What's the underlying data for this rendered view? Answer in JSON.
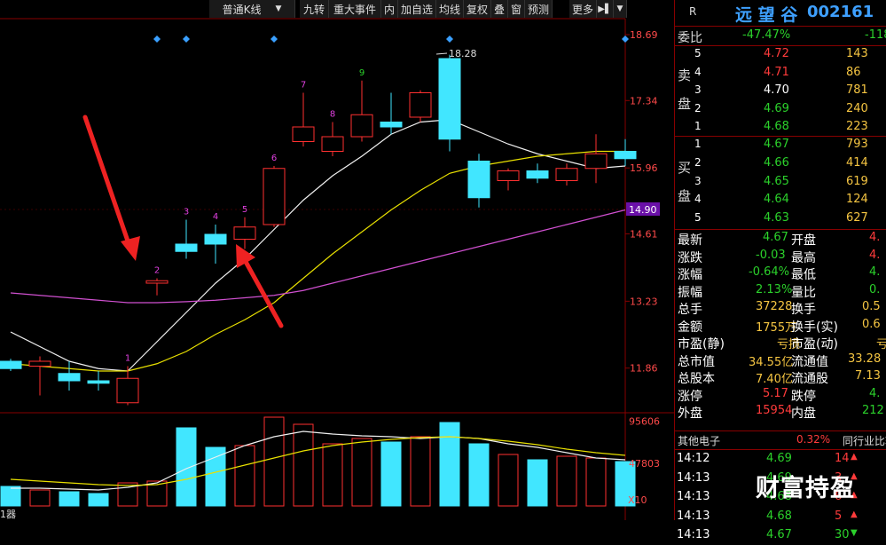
{
  "toolbar": {
    "items": [
      "普通K线",
      "▼",
      "九转",
      "重大事件",
      "内",
      "加自选",
      "均线",
      "复权",
      "叠",
      "窗",
      "预测",
      "更多"
    ],
    "nav_icon": "▶▌",
    "dropdown": "▼"
  },
  "stock": {
    "flag": "R",
    "name": "远 望 谷",
    "code": "002161"
  },
  "weibi": {
    "label": "委比",
    "pct": "-47.47%",
    "diff": "-118"
  },
  "sell_label": [
    "卖",
    "盘"
  ],
  "buy_label": [
    "买",
    "盘"
  ],
  "sell_orders": [
    {
      "level": "5",
      "price": "4.72",
      "vol": "143",
      "color": "red"
    },
    {
      "level": "4",
      "price": "4.71",
      "vol": "86",
      "color": "red"
    },
    {
      "level": "3",
      "price": "4.70",
      "vol": "781",
      "color": "white"
    },
    {
      "level": "2",
      "price": "4.69",
      "vol": "240",
      "color": "green"
    },
    {
      "level": "1",
      "price": "4.68",
      "vol": "223",
      "color": "green"
    }
  ],
  "buy_orders": [
    {
      "level": "1",
      "price": "4.67",
      "vol": "793",
      "color": "green"
    },
    {
      "level": "2",
      "price": "4.66",
      "vol": "414",
      "color": "green"
    },
    {
      "level": "3",
      "price": "4.65",
      "vol": "619",
      "color": "green"
    },
    {
      "level": "4",
      "price": "4.64",
      "vol": "124",
      "color": "green"
    },
    {
      "level": "5",
      "price": "4.63",
      "vol": "627",
      "color": "green"
    }
  ],
  "stats": [
    {
      "l1": "最新",
      "v1": "4.67",
      "c1": "green",
      "l2": "开盘",
      "v2": "4.",
      "c2": "red"
    },
    {
      "l1": "涨跌",
      "v1": "-0.03",
      "c1": "green",
      "l2": "最高",
      "v2": "4.",
      "c2": "red"
    },
    {
      "l1": "涨幅",
      "v1": "-0.64%",
      "c1": "green",
      "l2": "最低",
      "v2": "4.",
      "c2": "green"
    },
    {
      "l1": "振幅",
      "v1": "2.13%",
      "c1": "green",
      "l2": "量比",
      "v2": "0.",
      "c2": "green"
    },
    {
      "l1": "总手",
      "v1": "37228",
      "c1": "gold",
      "l2": "换手",
      "v2": "0.5",
      "c2": "gold"
    },
    {
      "l1": "金额",
      "v1": "1755万",
      "c1": "gold",
      "l2": "换手(实)",
      "v2": "0.6",
      "c2": "gold"
    },
    {
      "l1": "市盈(静)",
      "v1": "亏损",
      "c1": "gold",
      "l2": "市盈(动)",
      "v2": "亏",
      "c2": "gold"
    },
    {
      "l1": "总市值",
      "v1": "34.55亿",
      "c1": "gold",
      "l2": "流通值",
      "v2": "33.28",
      "c2": "gold"
    },
    {
      "l1": "总股本",
      "v1": "7.40亿",
      "c1": "gold",
      "l2": "流通股",
      "v2": "7.13",
      "c2": "gold"
    },
    {
      "l1": "涨停",
      "v1": "5.17",
      "c1": "red",
      "l2": "跌停",
      "v2": "4.",
      "c2": "green"
    },
    {
      "l1": "外盘",
      "v1": "15954",
      "c1": "red",
      "l2": "内盘",
      "v2": "212",
      "c2": "green"
    }
  ],
  "sector": {
    "name": "其他电子",
    "pct": "0.32%",
    "right": "同行业比较"
  },
  "ticks": [
    {
      "time": "14:12",
      "price": "4.69",
      "vol": "14",
      "dir": "up"
    },
    {
      "time": "14:13",
      "price": "4.69",
      "vol": "3",
      "dir": "up"
    },
    {
      "time": "14:13",
      "price": "4.68",
      "vol": "6",
      "dir": "up"
    },
    {
      "time": "14:13",
      "price": "4.68",
      "vol": "5",
      "dir": "up"
    },
    {
      "time": "14:13",
      "price": "4.67",
      "vol": "30",
      "dir": "down"
    }
  ],
  "watermark": "财富持盈",
  "chart_data": {
    "type": "candlestick",
    "price_ticks": [
      "18.69",
      "17.34",
      "15.96",
      "14.61",
      "13.23",
      "11.86"
    ],
    "current_price_label": "14.90",
    "max_label": "18.28",
    "volume_ticks": [
      "95606",
      "47803"
    ],
    "volume_unit": "X10",
    "left_label": "1器",
    "candles": [
      {
        "o": 12.0,
        "c": 11.85,
        "h": 12.05,
        "l": 11.8,
        "vol": 22000,
        "label": ""
      },
      {
        "o": 11.9,
        "c": 12.0,
        "h": 12.1,
        "l": 11.3,
        "vol": 18000,
        "label": ""
      },
      {
        "o": 11.75,
        "c": 11.6,
        "h": 12.0,
        "l": 11.4,
        "vol": 16000,
        "label": ""
      },
      {
        "o": 11.6,
        "c": 11.55,
        "h": 11.8,
        "l": 11.4,
        "vol": 14000,
        "label": ""
      },
      {
        "o": 11.15,
        "c": 11.65,
        "h": 11.9,
        "l": 11.1,
        "vol": 26000,
        "label": "1"
      },
      {
        "o": 13.6,
        "c": 13.65,
        "h": 13.7,
        "l": 13.35,
        "vol": 28000,
        "label": "2"
      },
      {
        "o": 14.4,
        "c": 14.25,
        "h": 14.9,
        "l": 14.1,
        "vol": 88000,
        "label": "3"
      },
      {
        "o": 14.6,
        "c": 14.4,
        "h": 14.8,
        "l": 14.0,
        "vol": 66000,
        "label": "4"
      },
      {
        "o": 14.5,
        "c": 14.75,
        "h": 14.95,
        "l": 14.3,
        "vol": 68000,
        "label": "5"
      },
      {
        "o": 14.8,
        "c": 15.95,
        "h": 16.0,
        "l": 14.75,
        "vol": 100000,
        "label": "6"
      },
      {
        "o": 16.5,
        "c": 16.8,
        "h": 17.5,
        "l": 16.4,
        "vol": 92000,
        "label": "7"
      },
      {
        "o": 16.3,
        "c": 16.6,
        "h": 16.9,
        "l": 16.2,
        "vol": 70000,
        "label": "8"
      },
      {
        "o": 16.6,
        "c": 17.05,
        "h": 17.75,
        "l": 16.5,
        "vol": 76000,
        "label": "9"
      },
      {
        "o": 16.9,
        "c": 16.8,
        "h": 17.5,
        "l": 16.65,
        "vol": 72000,
        "label": ""
      },
      {
        "o": 17.0,
        "c": 17.5,
        "h": 17.55,
        "l": 16.9,
        "vol": 78000,
        "label": ""
      },
      {
        "o": 18.2,
        "c": 16.55,
        "h": 18.28,
        "l": 16.3,
        "vol": 94000,
        "label": ""
      },
      {
        "o": 16.1,
        "c": 15.35,
        "h": 16.25,
        "l": 15.15,
        "vol": 70000,
        "label": ""
      },
      {
        "o": 15.7,
        "c": 15.9,
        "h": 15.95,
        "l": 15.5,
        "vol": 58000,
        "label": ""
      },
      {
        "o": 15.9,
        "c": 15.75,
        "h": 16.05,
        "l": 15.65,
        "vol": 52000,
        "label": ""
      },
      {
        "o": 15.7,
        "c": 15.95,
        "h": 16.05,
        "l": 15.6,
        "vol": 56000,
        "label": ""
      },
      {
        "o": 15.95,
        "c": 16.25,
        "h": 16.65,
        "l": 15.65,
        "vol": 54000,
        "label": ""
      },
      {
        "o": 16.3,
        "c": 16.15,
        "h": 16.55,
        "l": 16.0,
        "vol": 50000,
        "label": ""
      }
    ],
    "ma5": [
      12.6,
      12.3,
      12.0,
      11.85,
      11.8,
      12.4,
      13.0,
      13.6,
      14.1,
      14.7,
      15.3,
      15.8,
      16.2,
      16.65,
      16.9,
      16.95,
      16.7,
      16.45,
      16.25,
      16.1,
      15.95,
      16.0
    ],
    "ma10": [
      11.95,
      11.9,
      11.85,
      11.8,
      11.8,
      11.95,
      12.2,
      12.55,
      12.85,
      13.2,
      13.7,
      14.2,
      14.65,
      15.1,
      15.5,
      15.85,
      16.0,
      16.1,
      16.2,
      16.25,
      16.3,
      16.3
    ],
    "ma20": [
      13.4,
      13.35,
      13.3,
      13.25,
      13.2,
      13.2,
      13.22,
      13.25,
      13.3,
      13.35,
      13.45,
      13.6,
      13.75,
      13.9,
      14.05,
      14.2,
      14.35,
      14.5,
      14.65,
      14.8,
      14.95,
      15.1
    ],
    "vol_ma5": [
      20000,
      20000,
      19000,
      18000,
      21000,
      26000,
      42000,
      55000,
      68000,
      78000,
      84000,
      81000,
      79000,
      78000,
      76000,
      78000,
      76000,
      70000,
      66000,
      60000,
      54000,
      52000
    ],
    "vol_ma10": [
      30000,
      28000,
      26000,
      24000,
      23000,
      24000,
      30000,
      38000,
      46000,
      54000,
      62000,
      68000,
      72000,
      75000,
      77000,
      78000,
      76000,
      73000,
      69000,
      64000,
      60000,
      57000
    ],
    "diamonds": [
      5,
      6,
      9,
      15,
      21
    ],
    "axis_ylim": [
      11.0,
      19.0
    ]
  }
}
